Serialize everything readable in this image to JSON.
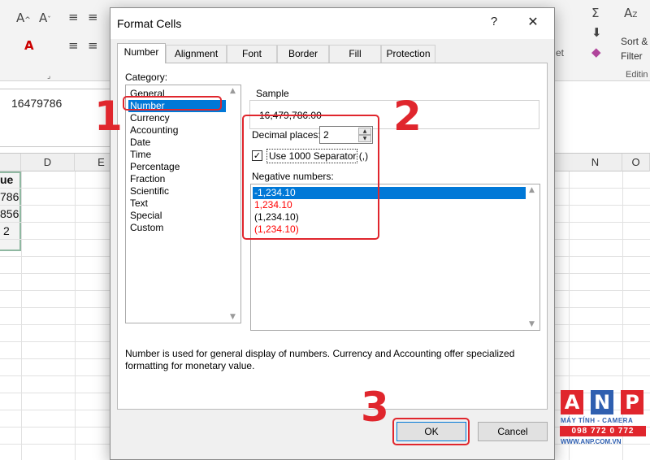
{
  "excel": {
    "formula_value": "16479786",
    "column_headers": [
      "D",
      "E",
      "N",
      "O"
    ],
    "cells": [
      "ue",
      "786",
      "856",
      "2"
    ],
    "ribbon_labels": {
      "sort_filter_1": "Sort &",
      "sort_filter_2": "Filter",
      "editing": "Editin",
      "partial_left": "et"
    }
  },
  "dialog": {
    "title": "Format Cells",
    "help_label": "?",
    "close_label": "✕",
    "tabs": [
      {
        "label": "Number",
        "active": true
      },
      {
        "label": "Alignment",
        "active": false
      },
      {
        "label": "Font",
        "active": false
      },
      {
        "label": "Border",
        "active": false
      },
      {
        "label": "Fill",
        "active": false
      },
      {
        "label": "Protection",
        "active": false
      }
    ],
    "category_label": "Category:",
    "categories": [
      "General",
      "Number",
      "Currency",
      "Accounting",
      "Date",
      "Time",
      "Percentage",
      "Fraction",
      "Scientific",
      "Text",
      "Special",
      "Custom"
    ],
    "selected_category": "Number",
    "sample_label": "Sample",
    "sample_value": "16,479,786.00",
    "decimal_places_label": "Decimal places:",
    "decimal_places_value": "2",
    "separator_label": "Use 1000 Separator (,)",
    "separator_checked": true,
    "negative_label": "Negative numbers:",
    "negative_options": [
      {
        "text": "-1,234.10",
        "color": "#000000",
        "selected": true
      },
      {
        "text": "1,234.10",
        "color": "#ff0000",
        "selected": false
      },
      {
        "text": "(1,234.10)",
        "color": "#000000",
        "selected": false
      },
      {
        "text": "(1,234.10)",
        "color": "#ff0000",
        "selected": false
      }
    ],
    "description": "Number is used for general display of numbers.  Currency and Accounting offer specialized formatting for monetary value.",
    "ok_label": "OK",
    "cancel_label": "Cancel"
  },
  "annotations": {
    "step1": "1",
    "step2": "2",
    "step3": "3",
    "accent_color": "#e0262d"
  },
  "watermark": {
    "letters": [
      "A",
      "N",
      "P"
    ],
    "subtitle": "MÁY TÍNH - CAMERA",
    "phone": "098 772 0 772",
    "website": "WWW.ANP.COM.VN"
  }
}
